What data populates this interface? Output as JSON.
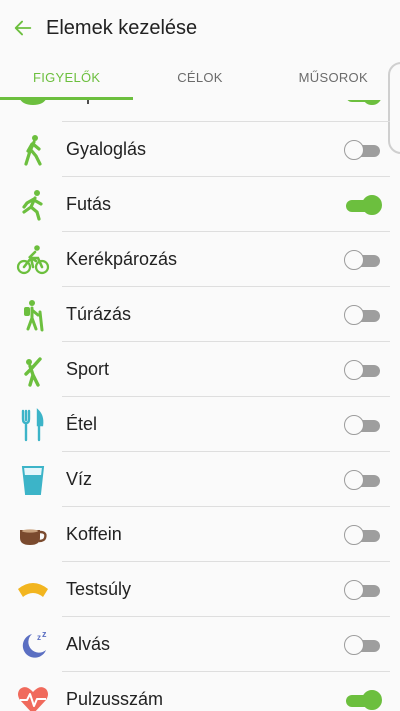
{
  "header": {
    "title": "Elemek kezelése",
    "back_icon": "back-arrow-icon"
  },
  "tabs": [
    {
      "label": "FIGYELŐK",
      "active": true
    },
    {
      "label": "CÉLOK",
      "active": false
    },
    {
      "label": "MŰSOROK",
      "active": false
    }
  ],
  "items": [
    {
      "label": "Lépések",
      "icon": "steps-icon",
      "on": true
    },
    {
      "label": "Gyaloglás",
      "icon": "walking-icon",
      "on": false
    },
    {
      "label": "Futás",
      "icon": "running-icon",
      "on": true
    },
    {
      "label": "Kerékpározás",
      "icon": "cycling-icon",
      "on": false
    },
    {
      "label": "Túrázás",
      "icon": "hiking-icon",
      "on": false
    },
    {
      "label": "Sport",
      "icon": "sport-icon",
      "on": false
    },
    {
      "label": "Étel",
      "icon": "food-icon",
      "on": false
    },
    {
      "label": "Víz",
      "icon": "water-icon",
      "on": false
    },
    {
      "label": "Koffein",
      "icon": "coffee-icon",
      "on": false
    },
    {
      "label": "Testsúly",
      "icon": "weight-icon",
      "on": false
    },
    {
      "label": "Alvás",
      "icon": "sleep-icon",
      "on": false
    },
    {
      "label": "Pulzusszám",
      "icon": "heart-rate-icon",
      "on": true
    }
  ],
  "colors": {
    "accent": "#6cbf3e",
    "toggle_off": "#9e9e9e"
  }
}
